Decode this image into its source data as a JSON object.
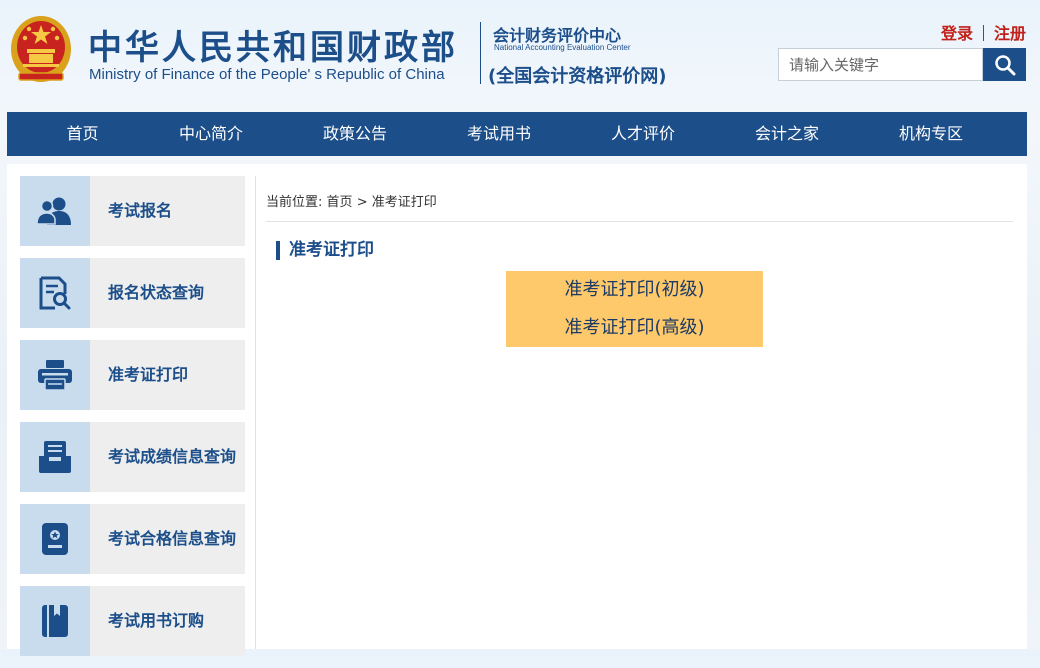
{
  "header": {
    "title_cn": "中华人民共和国财政部",
    "title_en": "Ministry of Finance of the People' s Republic of China",
    "center_cn": "会计财务评价中心",
    "center_en": "National Accounting Evaluation Center",
    "center_sub": "(全国会计资格评价网)",
    "login": "登录",
    "register": "注册",
    "search_placeholder": "请输入关键字"
  },
  "nav": {
    "items": [
      {
        "label": "首页"
      },
      {
        "label": "中心简介"
      },
      {
        "label": "政策公告"
      },
      {
        "label": "考试用书"
      },
      {
        "label": "人才评价"
      },
      {
        "label": "会计之家"
      },
      {
        "label": "机构专区"
      }
    ]
  },
  "sidebar": {
    "items": [
      {
        "label": "考试报名",
        "icon": "users-icon"
      },
      {
        "label": "报名状态查询",
        "icon": "document-search-icon"
      },
      {
        "label": "准考证打印",
        "icon": "printer-icon"
      },
      {
        "label": "考试成绩信息查询",
        "icon": "inbox-icon"
      },
      {
        "label": "考试合格信息查询",
        "icon": "certificate-icon"
      },
      {
        "label": "考试用书订购",
        "icon": "book-icon"
      }
    ]
  },
  "breadcrumb": {
    "prefix": "当前位置:",
    "home": "首页",
    "separator": ">",
    "current": "准考证打印"
  },
  "content": {
    "section_title": "准考证打印",
    "links": [
      {
        "label": "准考证打印(初级)"
      },
      {
        "label": "准考证打印(高级)"
      }
    ]
  },
  "colors": {
    "primary": "#1c4e8a",
    "accent_red": "#c0221b",
    "link_box": "#fec96a",
    "sidebar_icon_bg": "#c9dcee",
    "sidebar_bg": "#eeeeee"
  }
}
